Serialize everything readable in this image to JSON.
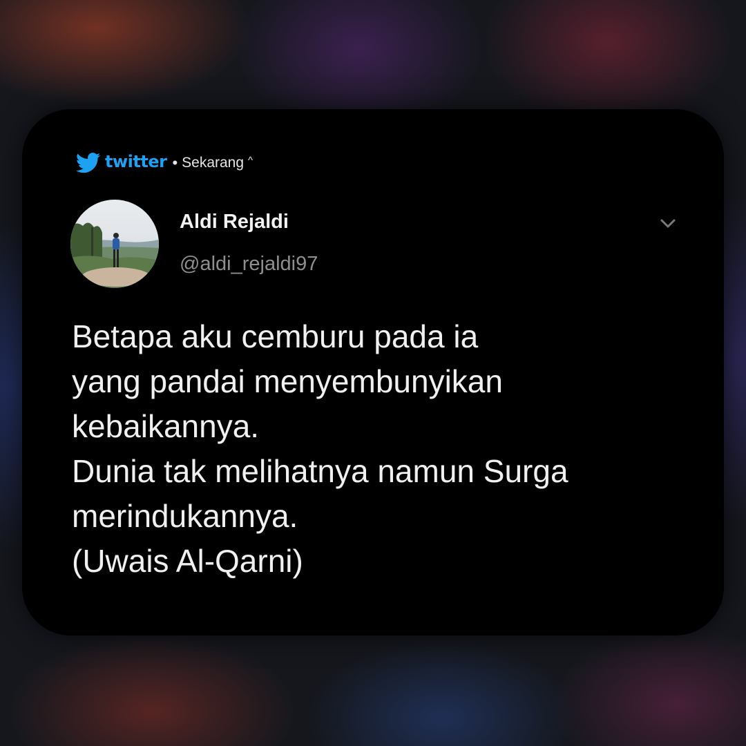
{
  "notification": {
    "app_name": "twitter",
    "separator": "•",
    "time": "Sekarang",
    "expand_caret": "^",
    "icons": {
      "app_icon": "twitter-bird-icon",
      "expand": "chevron-down-icon"
    },
    "colors": {
      "brand": "#1da1f2",
      "card_background": "#000000",
      "text": "#f0f0f0",
      "handle": "#8e8e8e"
    }
  },
  "tweet": {
    "author_name": "Aldi Rejaldi",
    "author_handle": "@aldi_rejaldi97",
    "lines": [
      "Betapa aku cemburu pada ia",
      "yang pandai menyembunyikan",
      "kebaikannya.",
      "Dunia tak melihatnya namun Surga",
      "merindukannya.",
      "(Uwais Al-Qarni)"
    ]
  }
}
